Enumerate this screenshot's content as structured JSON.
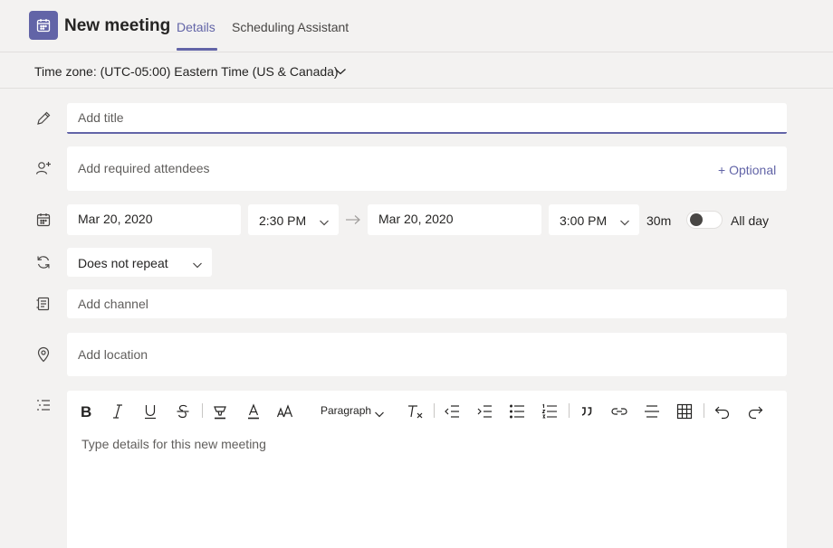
{
  "header": {
    "title": "New meeting",
    "tabs": [
      {
        "label": "Details",
        "active": true
      },
      {
        "label": "Scheduling Assistant",
        "active": false
      }
    ]
  },
  "timezone": {
    "label": "Time zone: (UTC-05:00) Eastern Time (US & Canada)"
  },
  "form": {
    "title_placeholder": "Add title",
    "attendees_placeholder": "Add required attendees",
    "optional_label": "+ Optional",
    "start_date": "Mar 20, 2020",
    "start_time": "2:30 PM",
    "end_date": "Mar 20, 2020",
    "end_time": "3:00 PM",
    "duration": "30m",
    "all_day_label": "All day",
    "all_day_on": false,
    "repeat": "Does not repeat",
    "channel_placeholder": "Add channel",
    "location_placeholder": "Add location"
  },
  "editor": {
    "paragraph_label": "Paragraph",
    "placeholder": "Type details for this new meeting",
    "toolbar": [
      "bold-icon",
      "italic-icon",
      "underline-icon",
      "strikethrough-icon",
      "highlight-icon",
      "font-color-icon",
      "font-size-icon",
      "clear-format-icon",
      "decrease-indent-icon",
      "increase-indent-icon",
      "bulleted-list-icon",
      "numbered-list-icon",
      "quote-icon",
      "link-icon",
      "horizontal-rule-icon",
      "table-icon",
      "undo-icon",
      "redo-icon"
    ]
  },
  "colors": {
    "accent": "#6264a7",
    "background": "#f3f2f1",
    "field": "#ffffff"
  }
}
